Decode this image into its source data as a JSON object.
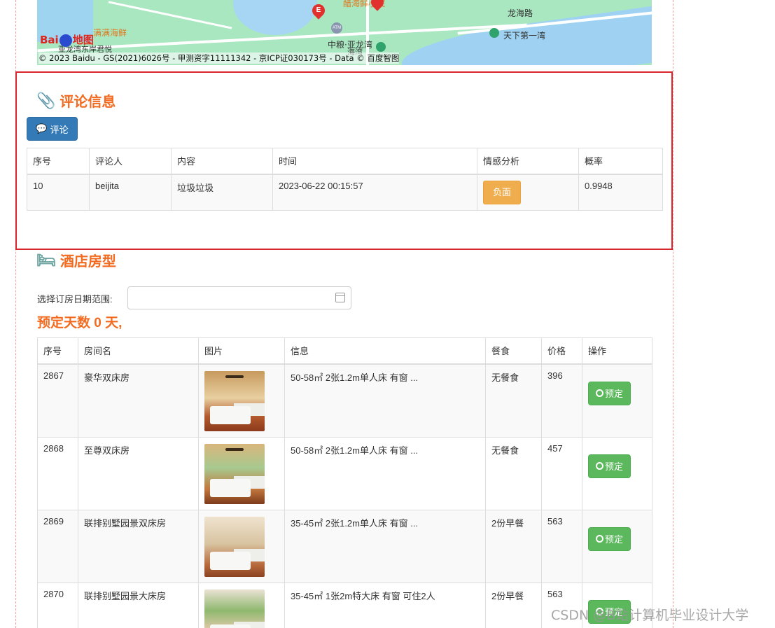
{
  "map": {
    "road_label": "龙海路",
    "poi_seafood": "满满海鲜",
    "poi_first_bay": "天下第一湾",
    "poi_yalong": "中粮·亚龙湾",
    "poi_yalong_sub": "海湾",
    "poi_rest": "醋海鲜小院",
    "poi_hotel": "亚龙湾东岸君悦",
    "pin_label": "E",
    "logo_text_left": "Bai",
    "logo_text_right": "地图",
    "atm_label": "ATM",
    "copyright": "© 2023 Baidu - GS(2021)6026号 - 甲测资字11111342 - 京ICP证030173号 - Data © 百度智图"
  },
  "comments": {
    "title": "评论信息",
    "button_label": "评论",
    "columns": [
      "序号",
      "评论人",
      "内容",
      "时间",
      "情感分析",
      "概率"
    ],
    "rows": [
      {
        "id": "10",
        "user": "beijita",
        "content": "垃圾垃圾",
        "time": "2023-06-22 00:15:57",
        "sentiment": "负面",
        "probability": "0.9948"
      }
    ]
  },
  "rooms": {
    "title": "酒店房型",
    "date_label": "选择订房日期范围:",
    "date_value": "",
    "days_text": "预定天数 0 天,",
    "columns": [
      "序号",
      "房间名",
      "图片",
      "信息",
      "餐食",
      "价格",
      "操作"
    ],
    "book_label": "预定",
    "rows": [
      {
        "id": "2867",
        "name": "豪华双床房",
        "info": "50-58㎡ 2张1.2m单人床 有窗 ...",
        "meal": "无餐食",
        "price": "396"
      },
      {
        "id": "2868",
        "name": "至尊双床房",
        "info": "50-58㎡ 2张1.2m单人床 有窗 ...",
        "meal": "无餐食",
        "price": "457"
      },
      {
        "id": "2869",
        "name": "联排别墅园景双床房",
        "info": "35-45㎡ 2张1.2m单人床 有窗 ...",
        "meal": "2份早餐",
        "price": "563"
      },
      {
        "id": "2870",
        "name": "联排别墅园景大床房",
        "info": "35-45㎡ 1张2m特大床 有窗 可住2人",
        "meal": "2份早餐",
        "price": "563"
      }
    ]
  },
  "watermark": "CSDN @B站计算机毕业设计大学",
  "colors": {
    "accent_orange": "#f26b21",
    "primary_blue": "#337ab7",
    "warning": "#f0ad4e",
    "success": "#5cb85c",
    "highlight_red": "#d9262c"
  }
}
